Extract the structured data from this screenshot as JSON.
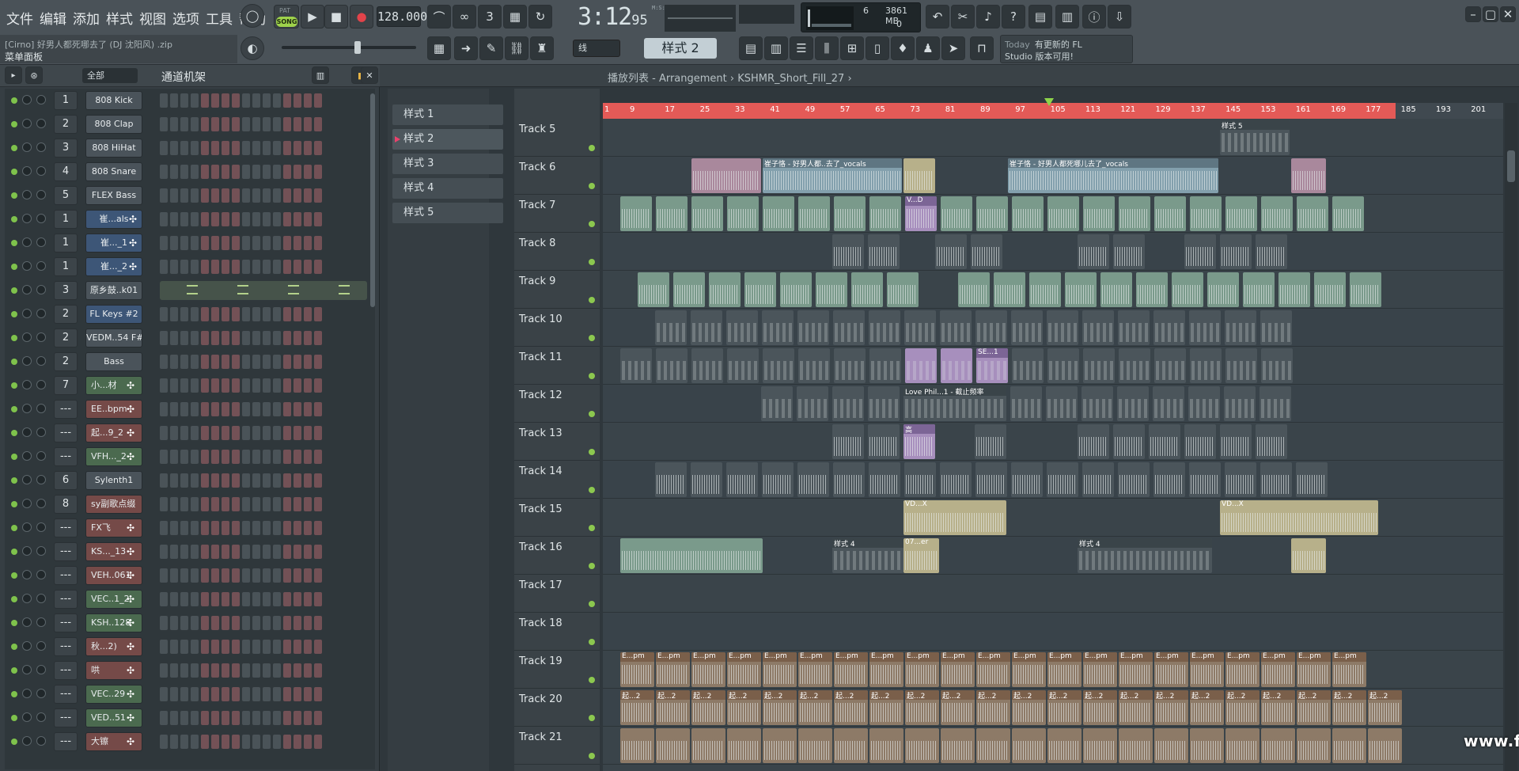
{
  "menu": [
    "文件",
    "编辑",
    "添加",
    "样式",
    "视图",
    "选项",
    "工具",
    "帮助"
  ],
  "transport": {
    "mode_pat": "PAT",
    "mode_song": "SONG",
    "tempo": "128.000"
  },
  "time": {
    "main": "3:12",
    "sub": "95",
    "label": "M:S:CS"
  },
  "cpu": {
    "polyphony": "6",
    "memory": "3861 MB",
    "value": "0"
  },
  "hint": {
    "line1": "[Cirno] 好男人都死哪去了 (DJ 沈阳风) .zip",
    "line2": "菜单面板"
  },
  "snap": "线",
  "pattern_selector": "样式 2",
  "news": {
    "label": "Today",
    "line1": "有更新的 FL",
    "line2": "Studio 版本可用!"
  },
  "rack": {
    "filter": "全部",
    "title": "通道机架",
    "channels": [
      {
        "num": "1",
        "name": "808 Kick",
        "style": "",
        "plug": ""
      },
      {
        "num": "2",
        "name": "808 Clap",
        "style": "",
        "plug": ""
      },
      {
        "num": "3",
        "name": "808 HiHat",
        "style": "",
        "plug": ""
      },
      {
        "num": "4",
        "name": "808 Snare",
        "style": "",
        "plug": ""
      },
      {
        "num": "5",
        "name": "FLEX Bass",
        "style": "",
        "plug": ""
      },
      {
        "num": "1",
        "name": "崔...als",
        "style": "bl",
        "plug": "✣"
      },
      {
        "num": "1",
        "name": "崔..._1",
        "style": "bl",
        "plug": "✣"
      },
      {
        "num": "1",
        "name": "崔..._2",
        "style": "bl",
        "plug": "✣"
      },
      {
        "num": "3",
        "name": "原乡鼓..k01",
        "style": "",
        "plug": "",
        "graph": true
      },
      {
        "num": "2",
        "name": "FL Keys #2",
        "style": "bl",
        "plug": ""
      },
      {
        "num": "2",
        "name": "VEDM..54 F#",
        "style": "",
        "plug": ""
      },
      {
        "num": "2",
        "name": "Bass",
        "style": "",
        "plug": ""
      },
      {
        "num": "7",
        "name": "小...材",
        "style": "gr",
        "plug": "✣"
      },
      {
        "num": "---",
        "name": "EE..bpm",
        "style": "rd",
        "plug": "✣"
      },
      {
        "num": "---",
        "name": "起...9_2",
        "style": "rd",
        "plug": "✣"
      },
      {
        "num": "---",
        "name": "VFH..._2",
        "style": "gr",
        "plug": "✣"
      },
      {
        "num": "6",
        "name": "Sylenth1",
        "style": "",
        "plug": ""
      },
      {
        "num": "8",
        "name": "sy副歌点缀",
        "style": "rd",
        "plug": ""
      },
      {
        "num": "---",
        "name": "FX飞",
        "style": "rd",
        "plug": "✣"
      },
      {
        "num": "---",
        "name": "KS..._13",
        "style": "rd",
        "plug": "✣"
      },
      {
        "num": "---",
        "name": "VEH..061",
        "style": "rd",
        "plug": "✣"
      },
      {
        "num": "---",
        "name": "VEC..1_2",
        "style": "gr",
        "plug": "✣"
      },
      {
        "num": "---",
        "name": "KSH..128",
        "style": "gr",
        "plug": "✣"
      },
      {
        "num": "---",
        "name": "秋...2)",
        "style": "rd",
        "plug": "✣"
      },
      {
        "num": "---",
        "name": "哄",
        "style": "rd",
        "plug": "✣"
      },
      {
        "num": "---",
        "name": "VEC..29",
        "style": "gr",
        "plug": "✣"
      },
      {
        "num": "---",
        "name": "VED..51",
        "style": "gr",
        "plug": "✣"
      },
      {
        "num": "---",
        "name": "大镲",
        "style": "rd",
        "plug": "✣"
      }
    ]
  },
  "playlist": {
    "title": "播放列表 - Arrangement › KSHMR_Short_Fill_27 ›",
    "patterns": [
      "样式 1",
      "样式 2",
      "样式 3",
      "样式 4",
      "样式 5"
    ],
    "selected_pattern": 1,
    "ruler": [
      "1",
      "9",
      "17",
      "25",
      "33",
      "41",
      "49",
      "57",
      "65",
      "73",
      "81",
      "89",
      "97",
      "105",
      "113",
      "121",
      "129",
      "137",
      "145",
      "153",
      "161",
      "169",
      "177",
      "185",
      "193",
      "201"
    ],
    "tracks": [
      "Track 5",
      "Track 6",
      "Track 7",
      "Track 8",
      "Track 9",
      "Track 10",
      "Track 11",
      "Track 12",
      "Track 13",
      "Track 14",
      "Track 15",
      "Track 16",
      "Track 17",
      "Track 18",
      "Track 19",
      "Track 20",
      "Track 21"
    ],
    "clip_labels": {
      "t5": "样式 5",
      "t6a": "崔子恪 - 好男人都..去了_vocals",
      "t6b": "崔子恪 - 好男人都死哪儿去了_vocals",
      "t7": "V...D",
      "t12": "Love Phil...1 - 截止频率",
      "t13": "高",
      "t11": "SE...1",
      "t16": "样式 4",
      "t16b": "07...er",
      "t19": "E...pm",
      "t20": "起...2",
      "t15": "VD...X"
    }
  },
  "watermark": "www.flpdown.com"
}
